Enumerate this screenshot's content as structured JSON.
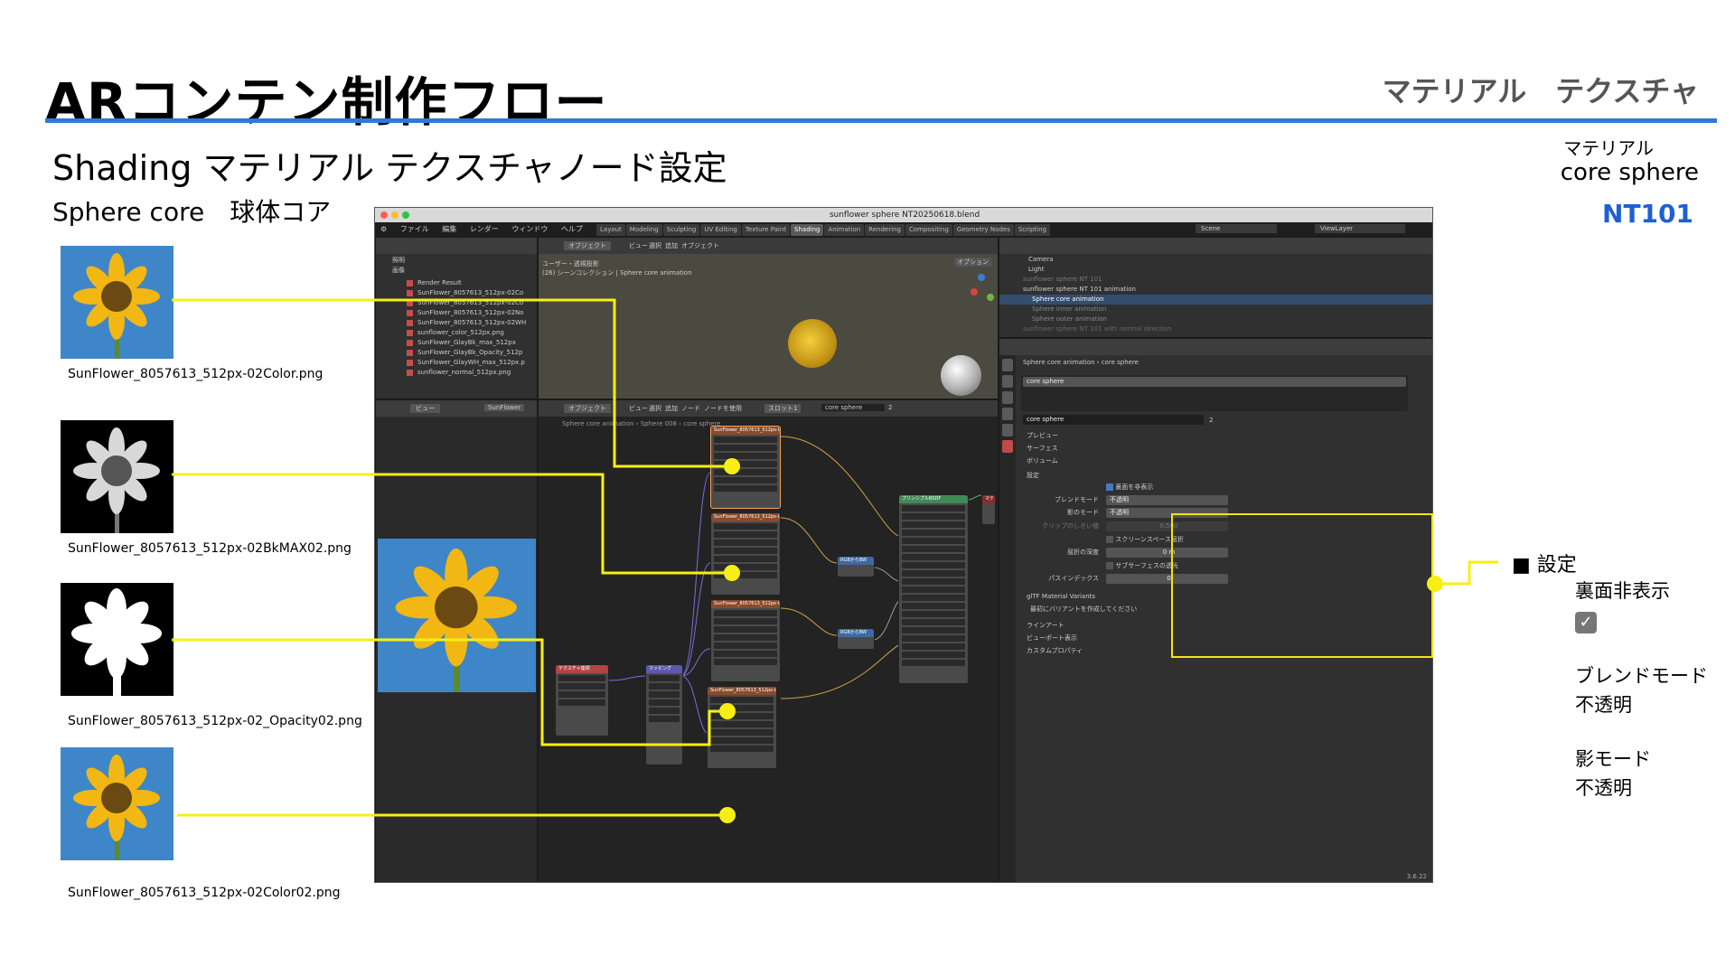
{
  "header": {
    "title": "ARコンテン制作フロー",
    "right_label": "マテリアル　テクスチャ",
    "subtitle": "Shading マテリアル テクスチャノード設定",
    "subtitle2": "Sphere core　球体コア"
  },
  "material_info": {
    "label": "マテリアル",
    "name": "core sphere",
    "code": "NT101"
  },
  "textures": [
    {
      "file": "SunFlower_8057613_512px-02Color.png",
      "kind": "color"
    },
    {
      "file": "SunFlower_8057613_512px-02BkMAX02.png",
      "kind": "bw"
    },
    {
      "file": "SunFlower_8057613_512px-02_Opacity02.png",
      "kind": "opacity"
    },
    {
      "file": "SunFlower_8057613_512px-02Color02.png",
      "kind": "color"
    }
  ],
  "blender": {
    "window_title": "sunflower sphere NT20250618.blend",
    "menus": [
      "ファイル",
      "編集",
      "レンダー",
      "ウィンドウ",
      "ヘルプ"
    ],
    "workspaces": [
      "Layout",
      "Modeling",
      "Sculpting",
      "UV Editing",
      "Texture Paint",
      "Shading",
      "Animation",
      "Rendering",
      "Compositing",
      "Geometry Nodes",
      "Scripting"
    ],
    "active_workspace": "Shading",
    "scene": "Scene",
    "view_layer": "ViewLayer",
    "file_browser": {
      "items": [
        "照明",
        "画像"
      ],
      "files": [
        "Render Result",
        "SunFlower_8057613_512px-02Co",
        "SunFlower_8057613_512px-02Co",
        "SunFlower_8057613_512px-02No",
        "SunFlower_8057613_512px-02WH",
        "sunflower_color_512px.png",
        "SunFlower_GlayBk_max_512px",
        "SunFlower_GlayBk_Opacity_512p",
        "SunFlower_GlayWH_max_512px.p",
        "sunflower_normal_512px.png"
      ]
    },
    "viewport": {
      "mode": "オブジェクト",
      "menus": [
        "ビュー",
        "選択",
        "追加",
        "オブジェクト"
      ],
      "info1": "ユーザー・透視投影",
      "info2": "(26) シーンコレクション | Sphere core animation",
      "options": "オプション"
    },
    "image_editor": {
      "view": "ビュー",
      "image": "SunFlower"
    },
    "node_editor": {
      "mode": "オブジェクト",
      "menus": [
        "ビュー",
        "選択",
        "追加",
        "ノード"
      ],
      "use_nodes": "ノードを使用",
      "slot": "スロット1",
      "material": "core sphere",
      "users": "2",
      "breadcrumb": [
        "Sphere core animation",
        "Sphere 008",
        "core sphere"
      ],
      "nodes": {
        "tex1": "SunFlower_8057613_512px-02Color0",
        "tex2": "SunFlower_8057613_512px-02BkMAX0",
        "tex3": "SunFlower_8057613_512px-02_Opaci",
        "tex4": "SunFlower_8057613_512px-02Color02",
        "texcoord": "テクスチャ座標",
        "mapping": "マッピング",
        "bsdf": "プリンシプルBSDF",
        "output": "マテリアル出力",
        "rgb2bw1": "RGBからBW",
        "rgb2bw2": "RGBからBW"
      }
    },
    "outliner": {
      "items": [
        "Camera",
        "Light",
        "sunflower sphere NT 101",
        "sunflower sphere NT 101 animation",
        "Sphere core animation",
        "Sphere inner animation",
        "Sphere outer animation",
        "sunflower sphere NT 101 with normal direction"
      ]
    },
    "properties": {
      "breadcrumb": [
        "Sphere core animation",
        "core sphere"
      ],
      "slot_name": "core sphere",
      "material_name": "core sphere",
      "users": "2",
      "sections": [
        "プレビュー",
        "サーフェス",
        "ボリューム"
      ],
      "settings_title": "設定",
      "backface_culling": "裏面を非表示",
      "blend_mode_label": "ブレンドモード",
      "blend_mode": "不透明",
      "shadow_mode_label": "影のモード",
      "shadow_mode": "不透明",
      "clip_label": "クリップのしきい値",
      "clip_value": "0.500",
      "screen_space": "スクリーンスペース屈折",
      "refraction_label": "屈折の深度",
      "refraction_value": "0 m",
      "subsurface": "サブサーフェスの透光",
      "pass_label": "パスインデックス",
      "pass_value": "0",
      "gltf": "glTF Material Variants",
      "gltf_note": "最初にバリアントを作成してください",
      "more_sections": [
        "ラインアート",
        "ビューポート表示",
        "カスタムプロパティ"
      ]
    },
    "version": "3.6.22"
  },
  "annotation": {
    "title": "■ 設定",
    "backface": "裏面非表示",
    "blend_label": "ブレンドモード",
    "blend_value": "不透明",
    "shadow_label": "影モード",
    "shadow_value": "不透明"
  },
  "colors": {
    "accent_rule": "#2e7ad9",
    "code_blue": "#1f5fd6",
    "callout_yellow": "#f7ef13"
  }
}
